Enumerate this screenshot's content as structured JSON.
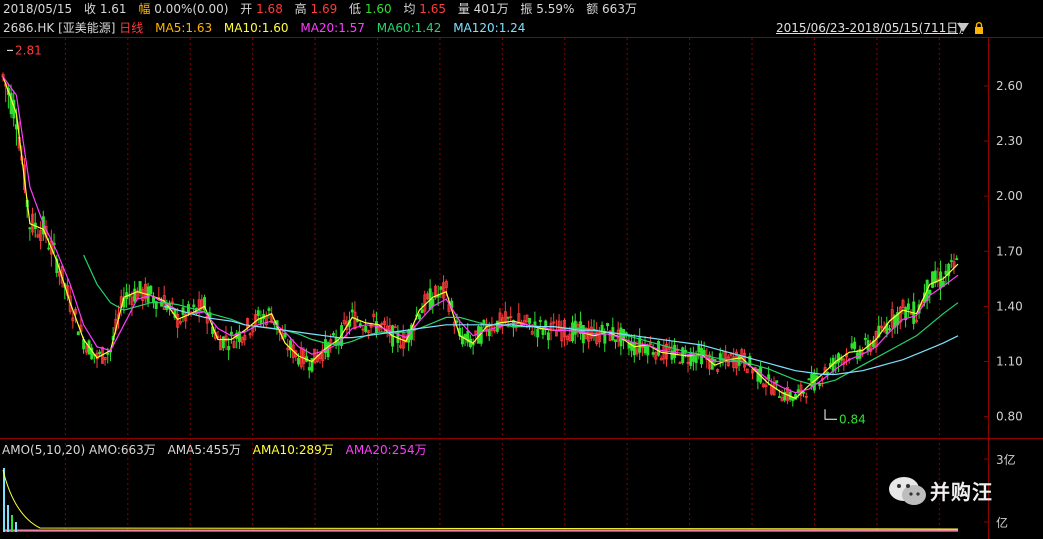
{
  "quote": {
    "date": "2018/05/15",
    "close_label": "收",
    "close": "1.61",
    "change_label": "幅",
    "change": "0.00%(0.00)",
    "open_label": "开",
    "open": "1.68",
    "high_label": "高",
    "high": "1.69",
    "low_label": "低",
    "low": "1.60",
    "avg_label": "均",
    "avg": "1.65",
    "volume_label": "量",
    "volume": "401万",
    "amplitude_label": "振",
    "amplitude": "5.59%",
    "amount_label": "额",
    "amount": "663万"
  },
  "info": {
    "code": "2686.HK",
    "name": "[亚美能源]",
    "period": "日线",
    "ma5": "MA5:1.63",
    "ma10": "MA10:1.60",
    "ma20": "MA20:1.57",
    "ma60": "MA60:1.42",
    "ma120": "MA120:1.24",
    "range": "2015/06/23-2018/05/15(711日)"
  },
  "amo": {
    "name": "AMO(5,10,20)",
    "amo": "AMO:663万",
    "ama5": "AMA5:455万",
    "ama10": "AMA10:289万",
    "ama20": "AMA20:254万"
  },
  "watermark": "并购汪",
  "colors": {
    "up": "#ff3b3b",
    "down": "#2ee02e",
    "ma5": "#ffff3a",
    "ma10": "#ffff3a",
    "ma20": "#ff3cff",
    "ma60": "#26d26c",
    "ma120": "#7ee0ff",
    "grid": "#8b0000"
  },
  "chart_data": [
    {
      "type": "line",
      "subtype": "candlestick",
      "ylim": [
        0.7,
        2.85
      ],
      "yticks": [
        "2.60",
        "2.30",
        "2.00",
        "1.70",
        "1.40",
        "1.10",
        "0.80"
      ],
      "yaxis_side": "right",
      "annotations": [
        {
          "label": "2.81",
          "value": 2.81,
          "position": "start"
        },
        {
          "label": "0.84",
          "value": 0.84,
          "position": "low"
        }
      ],
      "x": [
        0,
        10,
        20,
        30,
        40,
        50,
        60,
        70,
        80,
        90,
        100,
        110,
        120,
        130,
        140,
        150,
        160,
        170,
        180,
        190,
        200,
        210,
        220,
        230,
        240,
        250,
        260,
        270,
        280,
        290,
        300,
        310,
        320,
        330,
        340,
        350,
        360,
        370,
        380,
        390,
        400,
        410,
        420,
        430,
        440,
        450,
        460,
        470,
        480,
        490,
        500,
        510,
        520,
        530,
        540,
        550,
        560,
        570,
        580,
        590,
        600,
        610,
        620,
        630,
        640,
        650,
        660,
        670,
        680,
        690,
        700,
        711
      ],
      "series": [
        {
          "name": "MA5:1.63",
          "values": [
            2.65,
            2.45,
            1.85,
            1.82,
            1.65,
            1.42,
            1.22,
            1.12,
            1.16,
            1.45,
            1.48,
            1.46,
            1.43,
            1.33,
            1.36,
            1.4,
            1.22,
            1.22,
            1.27,
            1.33,
            1.36,
            1.2,
            1.13,
            1.1,
            1.17,
            1.22,
            1.34,
            1.31,
            1.3,
            1.24,
            1.21,
            1.38,
            1.45,
            1.48,
            1.24,
            1.2,
            1.29,
            1.31,
            1.32,
            1.3,
            1.28,
            1.27,
            1.27,
            1.26,
            1.24,
            1.26,
            1.23,
            1.18,
            1.19,
            1.15,
            1.14,
            1.13,
            1.14,
            1.08,
            1.11,
            1.12,
            1.05,
            0.98,
            0.93,
            0.9,
            0.97,
            1.03,
            1.1,
            1.15,
            1.16,
            1.22,
            1.32,
            1.38,
            1.36,
            1.52,
            1.55,
            1.63
          ]
        },
        {
          "name": "MA20:1.57",
          "values": [
            2.65,
            2.55,
            2.05,
            1.85,
            1.7,
            1.52,
            1.3,
            1.18,
            1.16,
            1.3,
            1.44,
            1.46,
            1.42,
            1.38,
            1.36,
            1.37,
            1.28,
            1.24,
            1.26,
            1.3,
            1.32,
            1.26,
            1.18,
            1.14,
            1.16,
            1.2,
            1.28,
            1.3,
            1.29,
            1.26,
            1.23,
            1.32,
            1.4,
            1.44,
            1.32,
            1.24,
            1.27,
            1.29,
            1.31,
            1.3,
            1.29,
            1.27,
            1.27,
            1.26,
            1.25,
            1.25,
            1.23,
            1.2,
            1.19,
            1.16,
            1.15,
            1.14,
            1.13,
            1.1,
            1.1,
            1.1,
            1.06,
            1.0,
            0.96,
            0.93,
            0.95,
            1.0,
            1.06,
            1.11,
            1.14,
            1.18,
            1.26,
            1.33,
            1.35,
            1.46,
            1.51,
            1.57
          ]
        },
        {
          "name": "MA60:1.42",
          "values": [
            null,
            null,
            null,
            null,
            null,
            null,
            1.68,
            1.52,
            1.42,
            1.38,
            1.4,
            1.42,
            1.42,
            1.41,
            1.39,
            1.37,
            1.35,
            1.33,
            1.3,
            1.29,
            1.28,
            1.27,
            1.25,
            1.22,
            1.2,
            1.19,
            1.21,
            1.24,
            1.26,
            1.26,
            1.26,
            1.28,
            1.31,
            1.34,
            1.34,
            1.32,
            1.3,
            1.3,
            1.29,
            1.29,
            1.29,
            1.29,
            1.28,
            1.28,
            1.27,
            1.26,
            1.25,
            1.23,
            1.21,
            1.19,
            1.17,
            1.15,
            1.14,
            1.12,
            1.11,
            1.1,
            1.08,
            1.06,
            1.03,
            1.0,
            0.98,
            0.98,
            1.0,
            1.04,
            1.08,
            1.12,
            1.16,
            1.2,
            1.24,
            1.3,
            1.36,
            1.42
          ]
        },
        {
          "name": "MA120:1.24",
          "values": [
            null,
            null,
            null,
            null,
            null,
            null,
            null,
            null,
            null,
            null,
            null,
            null,
            1.4,
            1.38,
            1.36,
            1.34,
            1.33,
            1.32,
            1.3,
            1.29,
            1.28,
            1.27,
            1.26,
            1.25,
            1.24,
            1.23,
            1.23,
            1.24,
            1.25,
            1.26,
            1.27,
            1.28,
            1.29,
            1.3,
            1.3,
            1.3,
            1.3,
            1.3,
            1.3,
            1.29,
            1.29,
            1.29,
            1.28,
            1.27,
            1.27,
            1.26,
            1.25,
            1.24,
            1.23,
            1.22,
            1.21,
            1.2,
            1.19,
            1.17,
            1.15,
            1.13,
            1.11,
            1.09,
            1.07,
            1.05,
            1.04,
            1.03,
            1.03,
            1.04,
            1.05,
            1.07,
            1.09,
            1.11,
            1.14,
            1.17,
            1.2,
            1.24
          ]
        }
      ]
    },
    {
      "type": "bar",
      "yticks": [
        "3亿",
        "亿"
      ],
      "legend": [
        "AMO:663万",
        "AMA5:455万",
        "AMA10:289万",
        "AMA20:254万"
      ]
    }
  ]
}
